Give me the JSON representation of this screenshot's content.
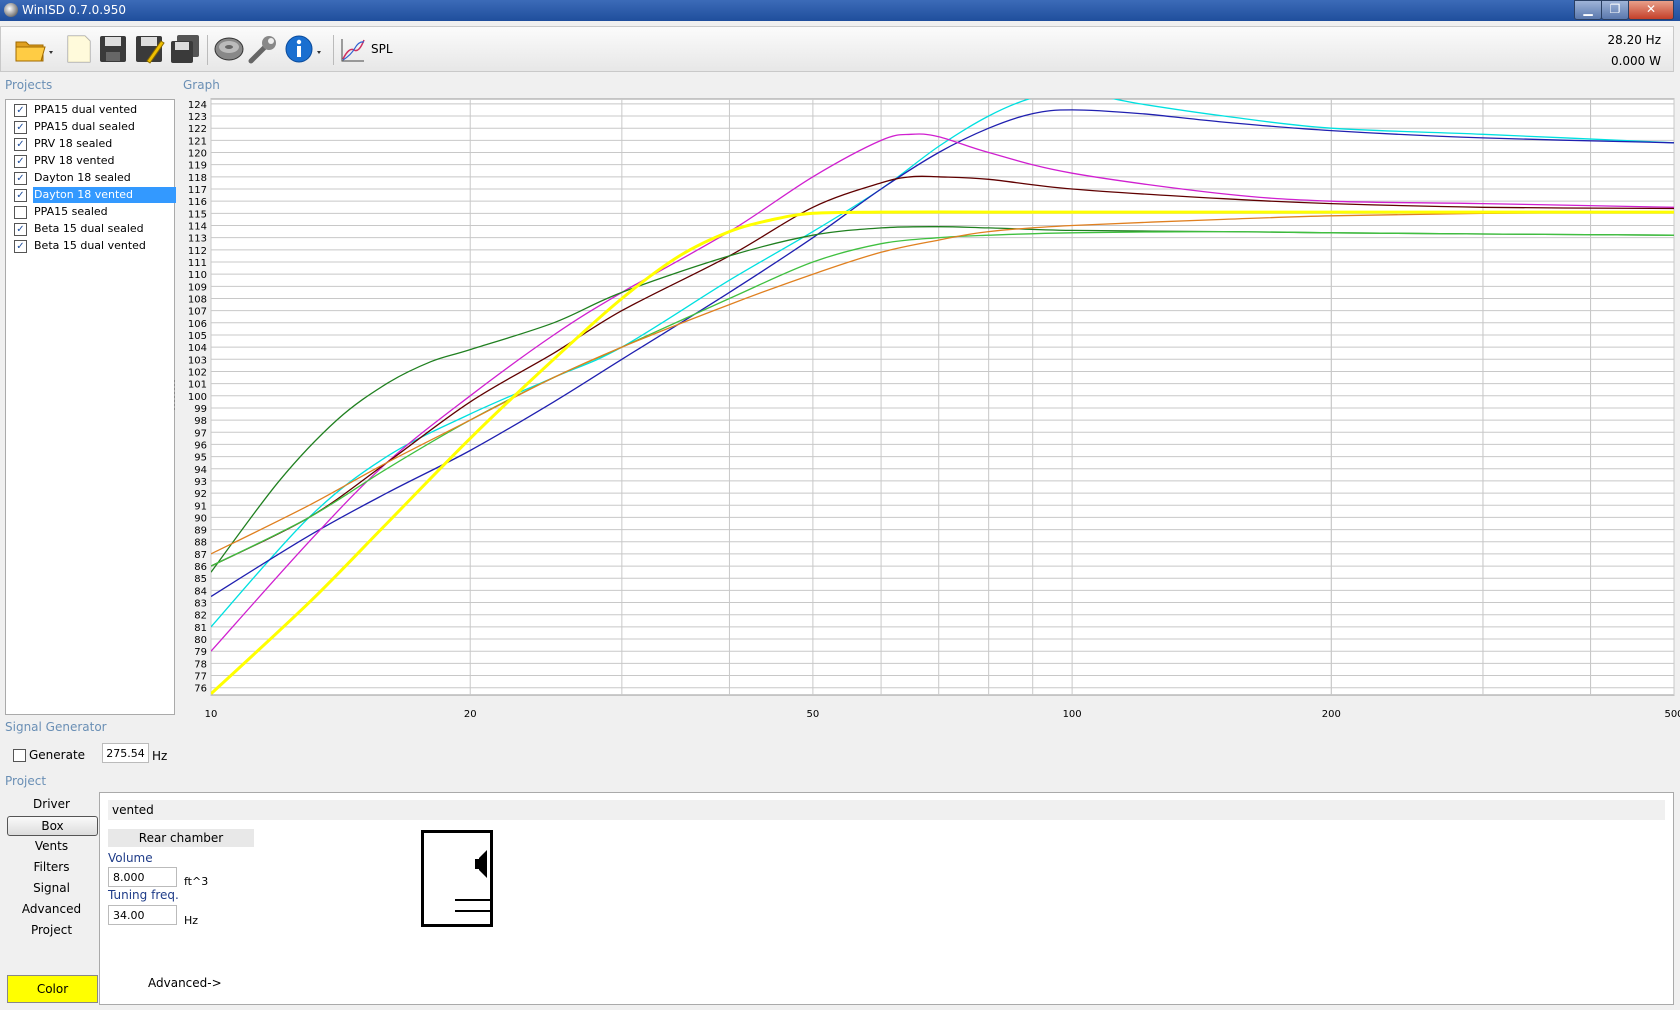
{
  "window": {
    "title": "WinISD 0.7.0.950",
    "minimize": "▁",
    "restore": "❐",
    "close": "✕"
  },
  "toolbar": {
    "spl_label": "SPL",
    "freq_readout": "28.20 Hz",
    "power_readout": "0.000 W"
  },
  "sections": {
    "projects": "Projects",
    "graph": "Graph",
    "signal_generator": "Signal Generator",
    "project": "Project"
  },
  "projects": [
    {
      "name": "PPA15 dual vented",
      "checked": true
    },
    {
      "name": "PPA15 dual sealed",
      "checked": true
    },
    {
      "name": "PRV 18 sealed",
      "checked": true
    },
    {
      "name": "PRV 18 vented",
      "checked": true
    },
    {
      "name": "Dayton 18 sealed",
      "checked": true
    },
    {
      "name": "Dayton 18 vented",
      "checked": true,
      "selected": true
    },
    {
      "name": "PPA15 sealed",
      "checked": false
    },
    {
      "name": "Beta 15 dual sealed",
      "checked": true
    },
    {
      "name": "Beta 15 dual vented",
      "checked": true
    }
  ],
  "signal_generator": {
    "generate_label": "Generate",
    "frequency": "275.54",
    "unit": "Hz"
  },
  "nav": [
    "Driver",
    "Box",
    "Vents",
    "Filters",
    "Signal",
    "Advanced",
    "Project"
  ],
  "nav_active": "Box",
  "box_panel": {
    "type": "vented",
    "chamber_label": "Rear chamber",
    "volume_label": "Volume",
    "volume": "8.000",
    "volume_unit": "ft^3",
    "tuning_label": "Tuning freq.",
    "tuning": "34.00",
    "tuning_unit": "Hz",
    "advanced_link": "Advanced->"
  },
  "color_button": {
    "label": "Color",
    "color": "#ffff00"
  },
  "chart_data": {
    "type": "line",
    "x_scale": "log",
    "xlim": [
      10,
      500
    ],
    "ylim": [
      76,
      124
    ],
    "x_ticks": [
      10,
      20,
      50,
      100,
      200,
      500
    ],
    "y_ticks": [
      76,
      77,
      78,
      79,
      80,
      81,
      82,
      83,
      84,
      85,
      86,
      87,
      88,
      89,
      90,
      91,
      92,
      93,
      94,
      95,
      96,
      97,
      98,
      99,
      100,
      101,
      102,
      103,
      104,
      105,
      106,
      107,
      108,
      109,
      110,
      111,
      112,
      113,
      114,
      115,
      116,
      117,
      118,
      119,
      120,
      121,
      122,
      123,
      124
    ],
    "grid": true,
    "series": [
      {
        "color": "#00e0e0",
        "x": [
          10,
          13,
          16,
          20,
          25,
          30,
          40,
          50,
          60,
          70,
          80,
          90,
          100,
          120,
          150,
          200,
          300,
          500
        ],
        "y": [
          81,
          90,
          95,
          98.5,
          101.5,
          104,
          109.5,
          113.5,
          117,
          120.5,
          123,
          124.5,
          125,
          124,
          123,
          122,
          121.5,
          120.8
        ]
      },
      {
        "color": "#2020b0",
        "x": [
          10,
          13,
          16,
          20,
          25,
          30,
          40,
          50,
          60,
          70,
          80,
          90,
          100,
          120,
          150,
          200,
          300,
          500
        ],
        "y": [
          83.5,
          88.5,
          92,
          95.5,
          99.5,
          103,
          108.5,
          113,
          117,
          120,
          122,
          123.2,
          123.5,
          123.2,
          122.5,
          121.8,
          121.2,
          120.8
        ]
      },
      {
        "color": "#d020d0",
        "x": [
          10,
          13,
          16,
          20,
          25,
          30,
          40,
          50,
          60,
          65,
          70,
          80,
          100,
          150,
          200,
          300,
          500
        ],
        "y": [
          79,
          88,
          94.5,
          100,
          105,
          108.5,
          113.5,
          118,
          121,
          121.5,
          121.3,
          120,
          118.3,
          116.6,
          116,
          115.8,
          115.5
        ]
      },
      {
        "color": "#600000",
        "x": [
          10,
          13,
          16,
          20,
          25,
          30,
          40,
          50,
          60,
          65,
          70,
          80,
          100,
          150,
          200,
          300,
          500
        ],
        "y": [
          86,
          90,
          94.5,
          99.5,
          103.5,
          107,
          111.5,
          115.5,
          117.5,
          118,
          118,
          117.8,
          117,
          116.2,
          115.8,
          115.5,
          115.4
        ]
      },
      {
        "color": "#208020",
        "x": [
          10,
          12,
          14,
          16,
          18,
          20,
          25,
          30,
          40,
          50,
          60,
          70,
          80,
          100,
          150,
          200,
          300,
          500
        ],
        "y": [
          85.5,
          93,
          98,
          101,
          102.8,
          103.8,
          106,
          108.5,
          111.5,
          113.2,
          113.8,
          113.9,
          113.8,
          113.6,
          113.5,
          113.4,
          113.3,
          113.2
        ]
      },
      {
        "color": "#40c040",
        "x": [
          10,
          13,
          16,
          20,
          25,
          30,
          40,
          50,
          60,
          70,
          80,
          100,
          150,
          200,
          300,
          500
        ],
        "y": [
          86,
          90,
          94,
          98,
          101.5,
          104,
          108,
          111,
          112.5,
          113,
          113.2,
          113.4,
          113.5,
          113.4,
          113.3,
          113.2
        ]
      },
      {
        "color": "#e08020",
        "x": [
          10,
          13,
          16,
          20,
          25,
          30,
          40,
          50,
          60,
          70,
          80,
          100,
          150,
          200,
          300,
          500
        ],
        "y": [
          87,
          91,
          94.5,
          98,
          101.5,
          104,
          107.5,
          110,
          111.8,
          112.8,
          113.5,
          114,
          114.5,
          114.8,
          115,
          115.1
        ]
      },
      {
        "color": "#ffff00",
        "x": [
          10,
          13,
          16,
          20,
          25,
          30,
          35,
          40,
          45,
          50,
          60,
          80,
          100,
          150,
          200,
          300,
          500
        ],
        "y": [
          75.5,
          83,
          89.5,
          96.5,
          103,
          108,
          111.5,
          113.5,
          114.5,
          115,
          115.1,
          115.1,
          115.1,
          115.1,
          115.1,
          115.1,
          115.1
        ]
      }
    ]
  }
}
